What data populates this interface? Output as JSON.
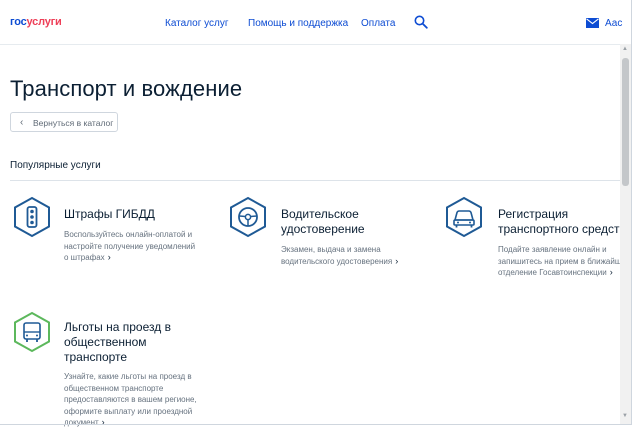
{
  "header": {
    "logo_part1": "гос",
    "logo_part2": "услуги",
    "nav": [
      "Каталог услуг",
      "Помощь и поддержка",
      "Оплата"
    ],
    "user_name": "Аас"
  },
  "page_title": "Транспорт и вождение",
  "back_button": "Вернуться в каталог",
  "section_title": "Популярные услуги",
  "services": [
    {
      "icon": "traffic-light-icon",
      "title_lines": [
        "Штрафы ГИБДД"
      ],
      "desc_lines": [
        "Воспользуйтесь онлайн-оплатой и",
        "настройте получение уведомлений",
        "о штрафах"
      ]
    },
    {
      "icon": "steering-wheel-icon",
      "title_lines": [
        "Водительское",
        "удостоверение"
      ],
      "desc_lines": [
        "Экзамен, выдача и замена",
        "водительского удостоверения"
      ]
    },
    {
      "icon": "car-icon",
      "title_lines": [
        "Регистрация",
        "транспортного средст"
      ],
      "desc_lines": [
        "Подайте заявление онлайн и",
        "запишитесь на прием в ближайш",
        "отделение Госавтоинспекции"
      ]
    },
    {
      "icon": "bus-icon",
      "title_lines": [
        "Льготы на проезд в",
        "общественном",
        "транспорте"
      ],
      "desc_lines": [
        "Узнайте, какие льготы на проезд в",
        "общественном транспорте",
        "предоставляются в вашем регионе,",
        "оформите выплату или проездной",
        "документ"
      ]
    }
  ],
  "colors": {
    "brand_blue": "#0d4cd3",
    "brand_red": "#ee3f58",
    "icon_border": "#1f5a95",
    "icon_green": "#5cb85c"
  }
}
